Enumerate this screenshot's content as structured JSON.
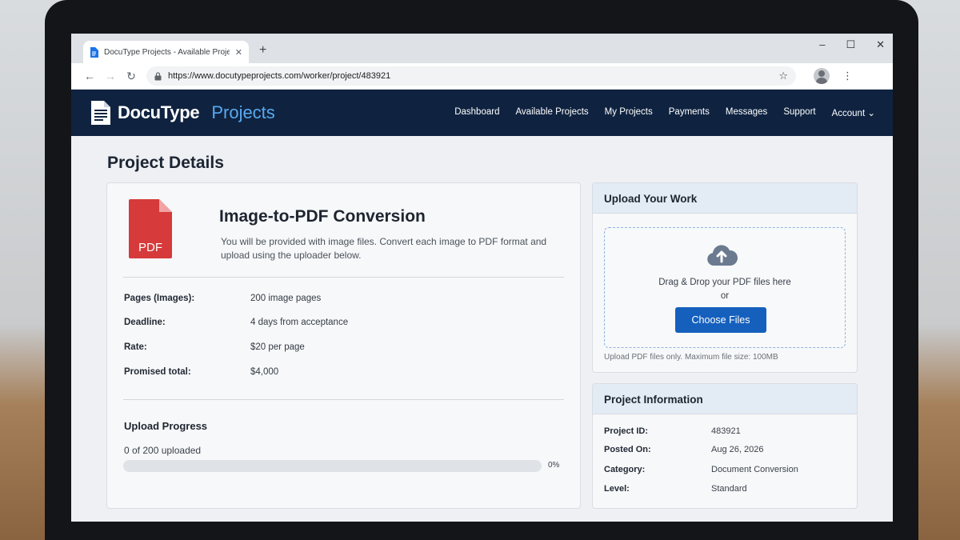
{
  "browser": {
    "tab_title": "DocuType Projects - Available Projects",
    "tab_close": "✕",
    "new_tab": "+",
    "window_controls": [
      "–",
      "☐",
      "✕"
    ],
    "url": "https://www.docutypeprojects.com/worker/project/483921"
  },
  "header": {
    "brand_primary": "DocuType",
    "brand_secondary": "Projects",
    "brand_accent": "#5aa9f0",
    "nav": [
      "Dashboard",
      "Available Projects",
      "My Projects",
      "Payments",
      "Messages",
      "Support",
      "Account"
    ]
  },
  "page": {
    "title": "Project Details"
  },
  "project": {
    "icon_label": "PDF",
    "title": "Image-to-PDF Conversion",
    "description": "You will be provided with image files. Convert each image to PDF format and upload using the uploader below.",
    "details": [
      {
        "label": "Pages (Images):",
        "value": "200 image pages"
      },
      {
        "label": "Deadline:",
        "value": "4 days from acceptance"
      },
      {
        "label": "Rate:",
        "value": "$20 per page"
      },
      {
        "label": "Promised total:",
        "value": "$4,000"
      }
    ]
  },
  "progress": {
    "title": "Upload Progress",
    "count_text": "0 of 200 uploaded",
    "percent_label": "0%",
    "fraction": 0
  },
  "upload": {
    "title": "Upload Your Work",
    "drop_text": "Drag & Drop your PDF files here",
    "or_text": "or",
    "button_label": "Choose Files",
    "note": "Upload PDF files only. Maximum file size: 100MB"
  },
  "info": {
    "title": "Project Information",
    "rows": [
      {
        "label": "Project ID:",
        "value": "483921"
      },
      {
        "label": "Posted On:",
        "value": "Aug 26, 2026"
      },
      {
        "label": "Category:",
        "value": "Document Conversion"
      },
      {
        "label": "Level:",
        "value": "Standard"
      }
    ]
  }
}
